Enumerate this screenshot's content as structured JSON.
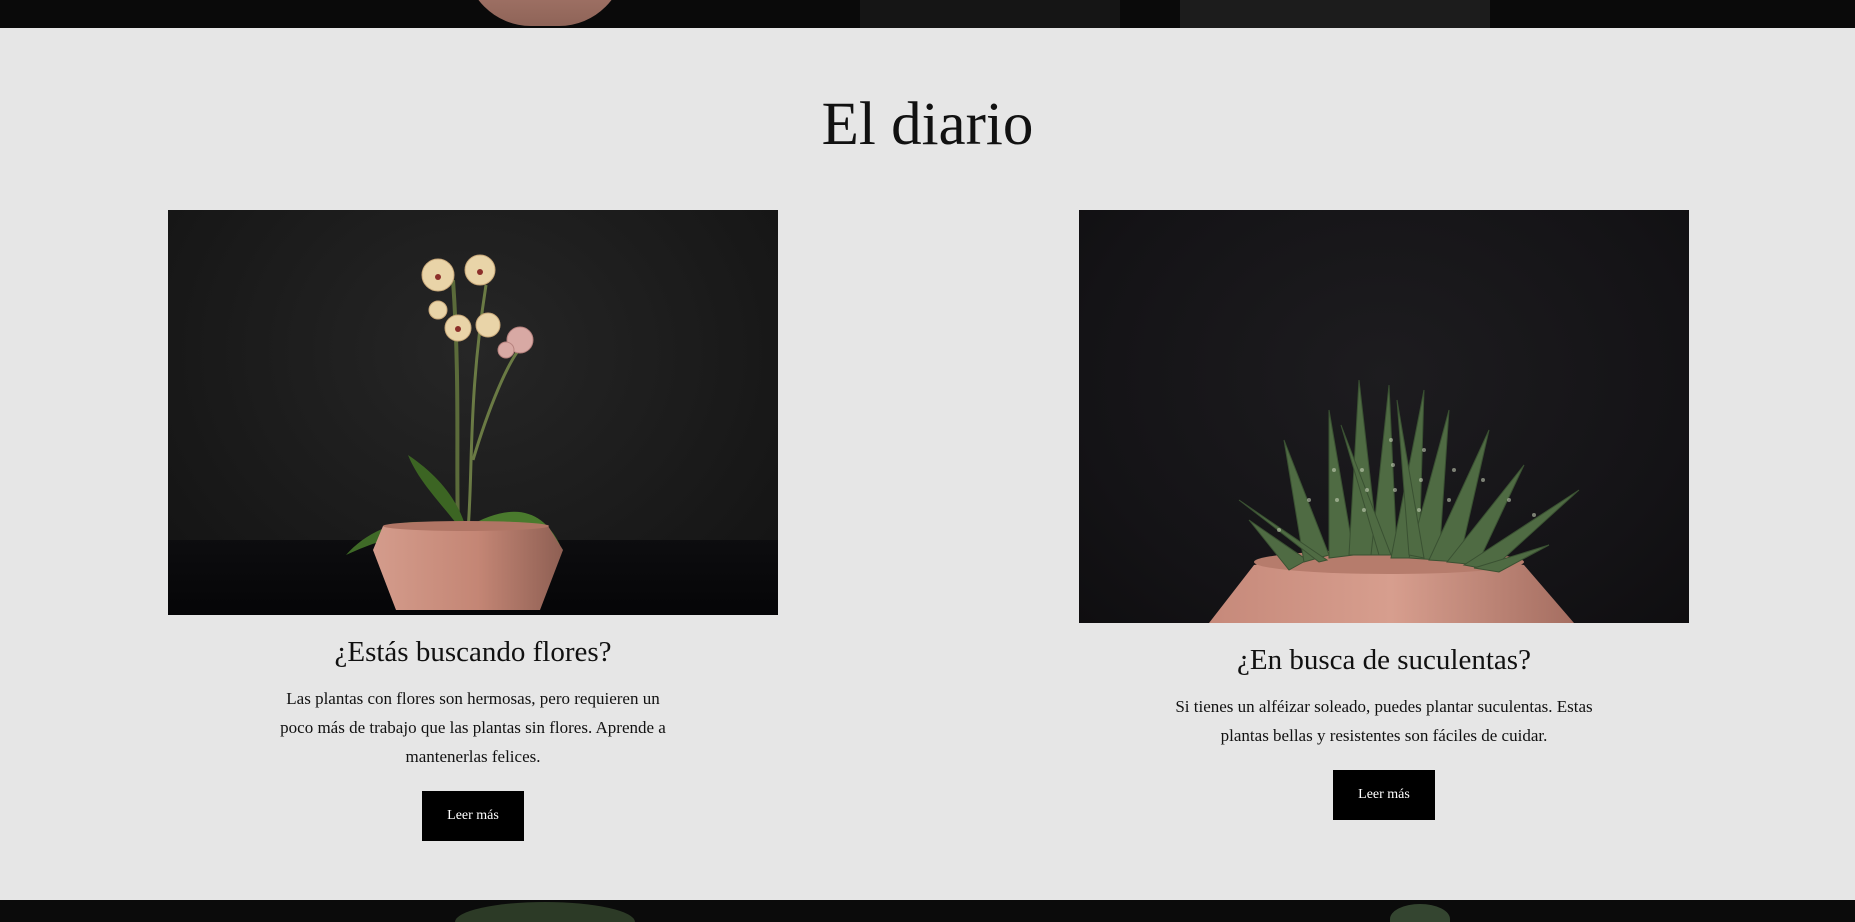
{
  "journal": {
    "title": "El diario"
  },
  "cards": [
    {
      "heading": "¿Estás buscando flores?",
      "text": "Las plantas con flores son hermosas, pero requieren un poco más de trabajo que las plantas sin flores. Aprende a mantenerlas felices.",
      "button_label": "Leer más",
      "image_subject": "orchid-in-terracotta-pot"
    },
    {
      "heading": "¿En busca de suculentas?",
      "text": "Si tienes un alféizar soleado, puedes plantar suculentas. Estas plantas bellas y resistentes son fáciles de cuidar.",
      "button_label": "Leer más",
      "image_subject": "succulent-in-terracotta-pot"
    }
  ],
  "colors": {
    "section_background": "#e6e6e6",
    "button_background": "#000000",
    "button_text": "#ffffff",
    "pot": "#c98f7e"
  }
}
